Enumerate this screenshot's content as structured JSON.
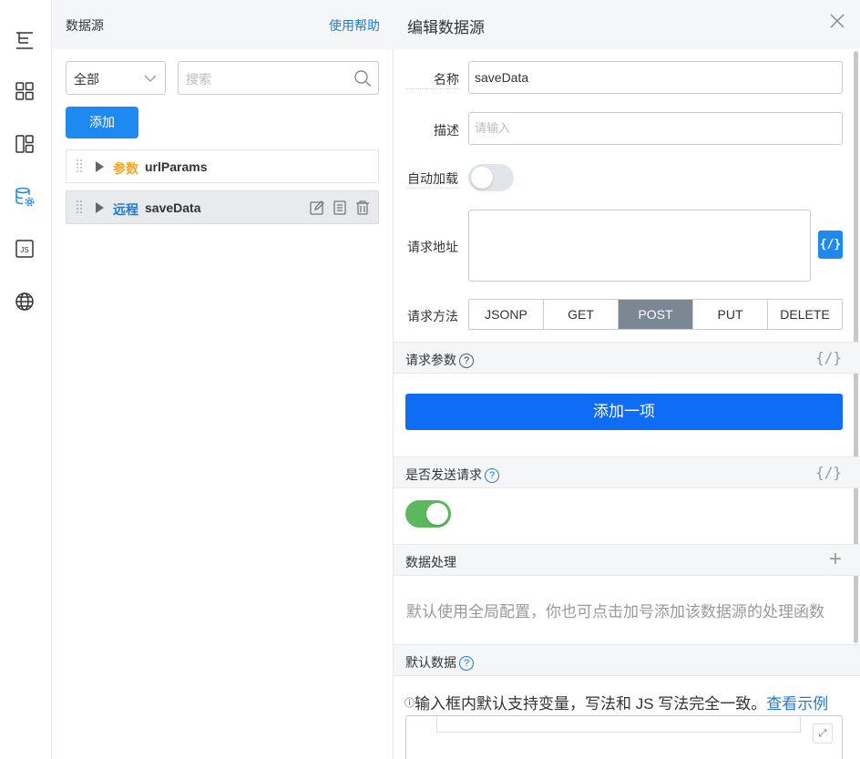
{
  "rail": {
    "icons": [
      "tree-icon",
      "grid-icon",
      "layout-icon",
      "database-settings-icon",
      "js-icon",
      "globe-icon"
    ],
    "js_label": "JS",
    "accent": "#1e89f0"
  },
  "panel": {
    "title": "数据源",
    "help": "使用帮助",
    "filter_value": "全部",
    "search_placeholder": "搜索",
    "add_label": "添加",
    "items": [
      {
        "type": "参数",
        "name": "urlParams",
        "type_color": "#f5a623"
      },
      {
        "type": "远程",
        "name": "saveData",
        "type_color": "#1d7bd6"
      }
    ]
  },
  "editor": {
    "title": "编辑数据源",
    "name_label": "名称",
    "name_value": "saveData",
    "desc_label": "描述",
    "desc_placeholder": "请输入",
    "autoload_label": "自动加载",
    "url_label": "请求地址",
    "code_btn": "{/}",
    "method_label": "请求方法",
    "methods": [
      "JSONP",
      "GET",
      "POST",
      "PUT",
      "DELETE"
    ],
    "method_selected": "POST",
    "params_section": "请求参数",
    "code_mark": "{/}",
    "add_item": "添加一项",
    "send_section": "是否发送请求",
    "process_section": "数据处理",
    "process_plus": "+",
    "process_hint": "默认使用全局配置，你也可点击加号添加该数据源的处理函数",
    "default_section": "默认数据",
    "note_info": "ⓘ",
    "note_text": "输入框内默认支持变量，写法和 JS 写法完全一致。",
    "note_link": "查看示例",
    "expand_glyph": "⤢",
    "question": "?",
    "toggle_on_color": "#5cb85c"
  }
}
